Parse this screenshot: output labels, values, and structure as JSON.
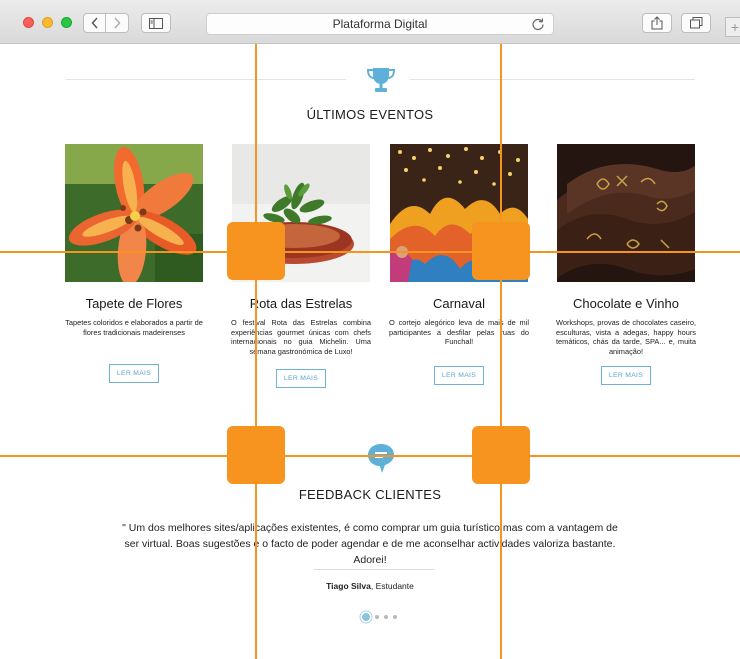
{
  "browser": {
    "address_text": "Plataforma Digital",
    "new_tab_symbol": "+"
  },
  "events": {
    "section_title": "ÚLTIMOS EVENTOS",
    "icon": "trophy-icon",
    "cards": [
      {
        "title": "Tapete de Flores",
        "description": "Tapetes coloridos e elaborados a partir de flores tradicionais madeirenses",
        "button": "LER MAIS",
        "image": "orange lily flower"
      },
      {
        "title": "Rota das Estrelas",
        "description": "O festival Rota das Estrelas combina experiências gourmet únicas com chefs internacionais no guia Michelin. Uma semana gastronómica de Luxo!",
        "button": "LER MAIS",
        "image": "gourmet dish with herbs"
      },
      {
        "title": "Carnaval",
        "description": "O cortejo alegórico leva de mais de mil participantes a desfilar pelas ruas do Funchal!",
        "button": "LER MAIS",
        "image": "carnival costumes with lights"
      },
      {
        "title": "Chocolate e Vinho",
        "description": "Workshops, provas de chocolates caseiro, esculturas, vista a adegas, happy hours temáticos, chás da tarde, SPA... e, muita animação!",
        "button": "LER MAIS",
        "image": "chocolate ribbon with gold lettering"
      }
    ]
  },
  "feedback": {
    "section_title": "FEEDBACK CLIENTES",
    "icon": "speech-bubble-icon",
    "quote": "\" Um dos melhores sites/aplicações existentes, é como comprar um guia turístico mas com a vantagem de ser virtual. Boas sugestões e o facto de poder agendar e de me aconselhar actividades valoriza bastante. Adorei!",
    "author_name": "Tiago Silva",
    "author_role": ", Estudante",
    "pagination": {
      "total": 4,
      "active": 1
    }
  },
  "colors": {
    "accent_blue": "#6fb2d6",
    "overlay_orange": "#f6941f"
  }
}
